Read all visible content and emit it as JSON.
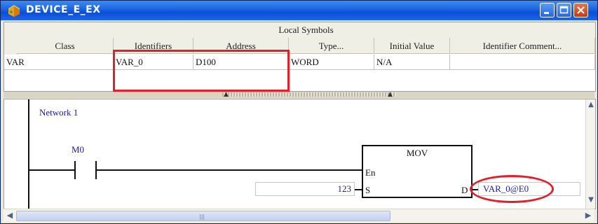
{
  "window": {
    "title": "DEVICE_E_EX"
  },
  "symbols": {
    "title": "Local Symbols",
    "columns": [
      "Class",
      "Identifiers",
      "Address",
      "Type...",
      "Initial Value",
      "Identifier Comment..."
    ],
    "row": {
      "class": "VAR",
      "identifier": "VAR_0",
      "address": "D100",
      "type": "WORD",
      "initial_value": "N/A",
      "comment": ""
    }
  },
  "ladder": {
    "network_label": "Network 1",
    "contact_label": "M0",
    "instruction": {
      "name": "MOV",
      "pin_en": "En",
      "pin_s": "S",
      "pin_d": "D"
    },
    "operand_s": "123",
    "operand_d": "VAR_0@E0"
  },
  "colors": {
    "highlight": "#e0202a",
    "operand_text": "#1a1aa0",
    "titlebar": "#0a4fd6"
  },
  "icons": [
    "app-icon",
    "minimize-icon",
    "maximize-icon",
    "close-icon",
    "scroll-up-icon",
    "scroll-down-icon",
    "scroll-left-icon",
    "scroll-right-icon",
    "splitter-arrow-icon"
  ]
}
